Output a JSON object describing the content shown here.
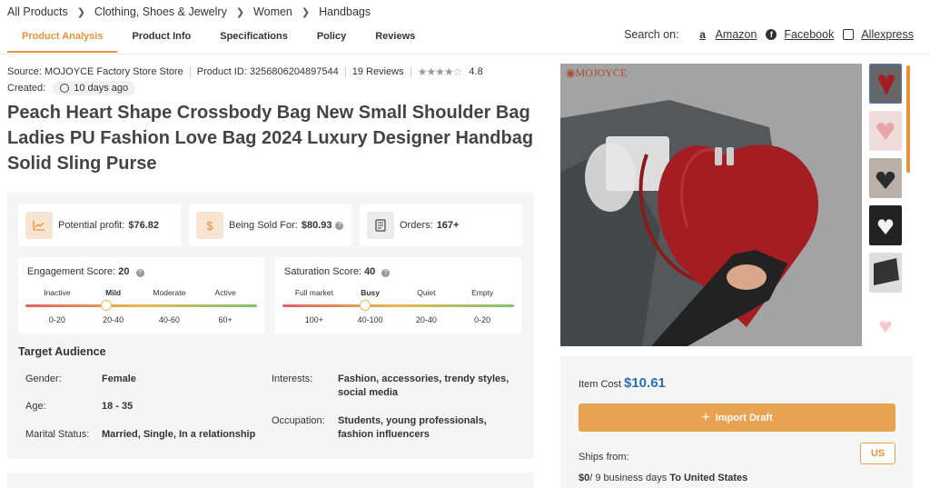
{
  "breadcrumb": [
    "All Products",
    "Clothing, Shoes & Jewelry",
    "Women",
    "Handbags"
  ],
  "tabs": [
    "Product Analysis",
    "Product Info",
    "Specifications",
    "Policy",
    "Reviews"
  ],
  "search_on": {
    "label": "Search on:",
    "sites": [
      {
        "name": "Amazon",
        "icon": "amazon-icon"
      },
      {
        "name": "Facebook",
        "icon": "facebook-icon"
      },
      {
        "name": "Allexpress",
        "icon": "mail-icon"
      }
    ]
  },
  "meta": {
    "source": "Source: MOJOYCE Factory Store Store",
    "product_id": "Product ID: 3256806204897544",
    "reviews": "19 Reviews",
    "rating": "4.8",
    "created_label": "Created:",
    "created_value": "10 days ago"
  },
  "title": "Peach Heart Shape Crossbody Bag New Small Shoulder Bag Ladies PU Fashion Love Bag 2024 Luxury Designer Handbag Solid Sling Purse",
  "stats": {
    "profit_label": "Potential profit:",
    "profit_value": "$76.82",
    "sold_label": "Being Sold For:",
    "sold_value": "$80.93",
    "orders_label": "Orders:",
    "orders_value": "167+"
  },
  "engagement": {
    "label": "Engagement Score:",
    "value": "20",
    "levels": [
      "Inactive",
      "Mild",
      "Moderate",
      "Active"
    ],
    "ranges": [
      "0-20",
      "20-40",
      "40-60",
      "60+"
    ],
    "active_index": 1
  },
  "saturation": {
    "label": "Saturation Score:",
    "value": "40",
    "levels": [
      "Full market",
      "Busy",
      "Quiet",
      "Empty"
    ],
    "ranges": [
      "100+",
      "40-100",
      "20-40",
      "0-20"
    ],
    "active_index": 1
  },
  "audience": {
    "title": "Target Audience",
    "gender_label": "Gender:",
    "gender": "Female",
    "age_label": "Age:",
    "age": "18 - 35",
    "marital_label": "Marital Status:",
    "marital": "Married, Single, In a relationship",
    "interests_label": "Interests:",
    "interests": "Fashion, accessories, trendy styles, social media",
    "occupation_label": "Occupation:",
    "occupation": "Students, young professionals, fashion influencers"
  },
  "product_image": {
    "brand": "MOJOYCE"
  },
  "cost": {
    "label": "Item Cost",
    "value": "$10.61",
    "import_label": "Import Draft",
    "ships_label": "Ships from:",
    "country": "US",
    "delivery_price": "$0",
    "delivery_days": "/ 9 business days",
    "delivery_dest": "To United States"
  },
  "colors": {
    "accent": "#e9913a",
    "price": "#2a6fb5",
    "panel": "#f5f5f5"
  }
}
